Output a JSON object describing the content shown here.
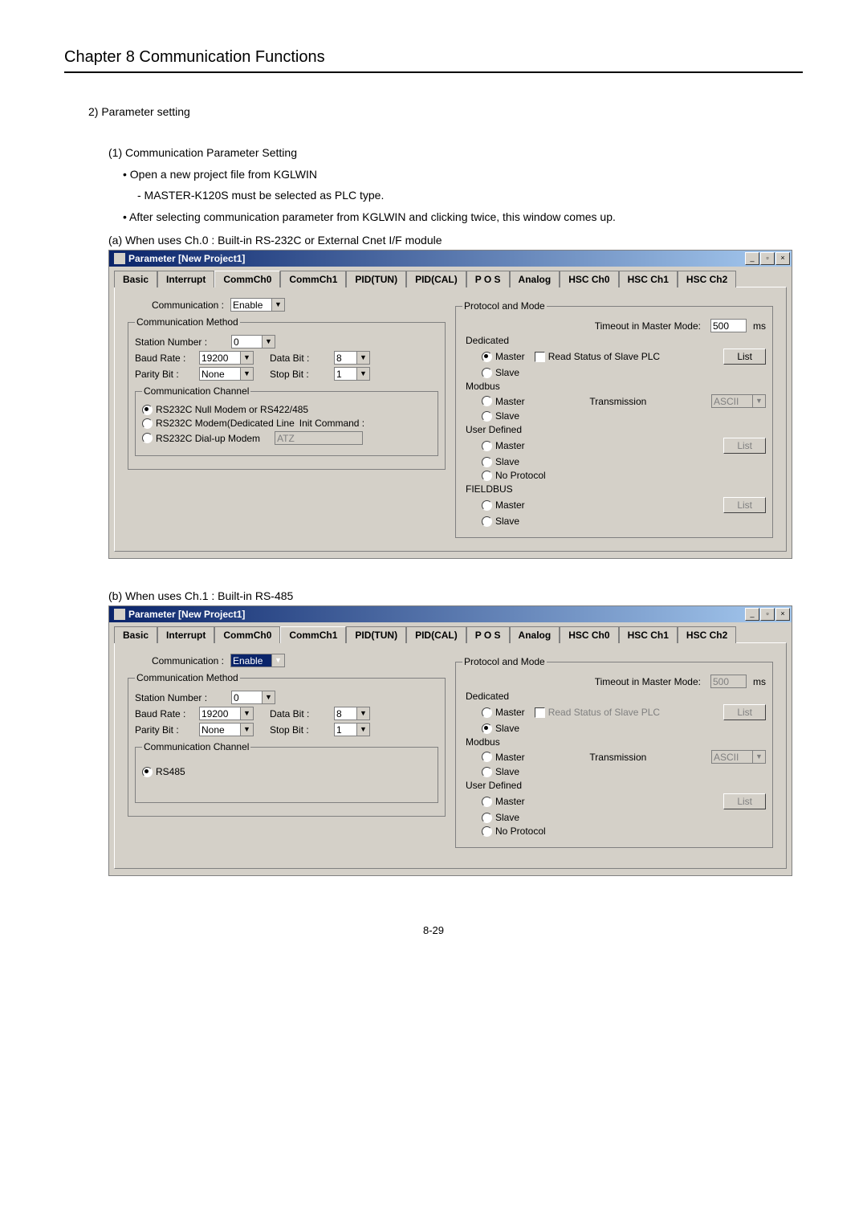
{
  "chapter": "Chapter 8   Communication Functions",
  "section": "2) Parameter setting",
  "step1": "(1) Communication Parameter Setting",
  "b1": "• Open a new project file from KGLWIN",
  "b1a": "- MASTER-K120S must be selected as PLC type.",
  "b2": "• After selecting communication parameter from KGLWIN and clicking twice, this window comes up.",
  "cap_a": "(a) When uses Ch.0 : Built-in RS-232C or External Cnet I/F module",
  "cap_b": "(b) When uses Ch.1 : Built-in RS-485",
  "page_no": "8-29",
  "dlg": {
    "title": "Parameter [New Project1]",
    "win_min": "_",
    "win_max": "▫",
    "win_close": "×",
    "tabs": [
      "Basic",
      "Interrupt",
      "CommCh0",
      "CommCh1",
      "PID(TUN)",
      "PID(CAL)",
      "P O S",
      "Analog",
      "HSC Ch0",
      "HSC Ch1",
      "HSC Ch2"
    ],
    "comm_lbl": "Communication :",
    "enable": "Enable",
    "comm_method_legend": "Communication Method",
    "station_lbl": "Station Number :",
    "station_val": "0",
    "baud_lbl": "Baud Rate :",
    "baud_val": "19200",
    "data_lbl": "Data Bit :",
    "data_val": "8",
    "parity_lbl": "Parity Bit :",
    "parity_val": "None",
    "stop_lbl": "Stop Bit :",
    "stop_val": "1",
    "comm_channel_legend": "Communication Channel",
    "ch_opt1": "RS232C Null Modem or RS422/485",
    "ch_opt2": "RS232C Modem(Dedicated Line",
    "ch_opt2b": "Init Command :",
    "ch_opt3": "RS232C Dial-up Modem",
    "atz": "ATZ",
    "ch_rs485": "RS485",
    "proto_legend": "Protocol and Mode",
    "timeout_lbl": "Timeout in Master Mode:",
    "timeout_val": "500",
    "ms": "ms",
    "dedicated": "Dedicated",
    "modbus": "Modbus",
    "userdef": "User Defined",
    "fieldbus": "FIELDBUS",
    "master": "Master",
    "slave": "Slave",
    "noproto": "No Protocol",
    "readstatus": "Read Status of Slave PLC",
    "transmission": "Transmission",
    "ascii": "ASCII",
    "list": "List"
  }
}
